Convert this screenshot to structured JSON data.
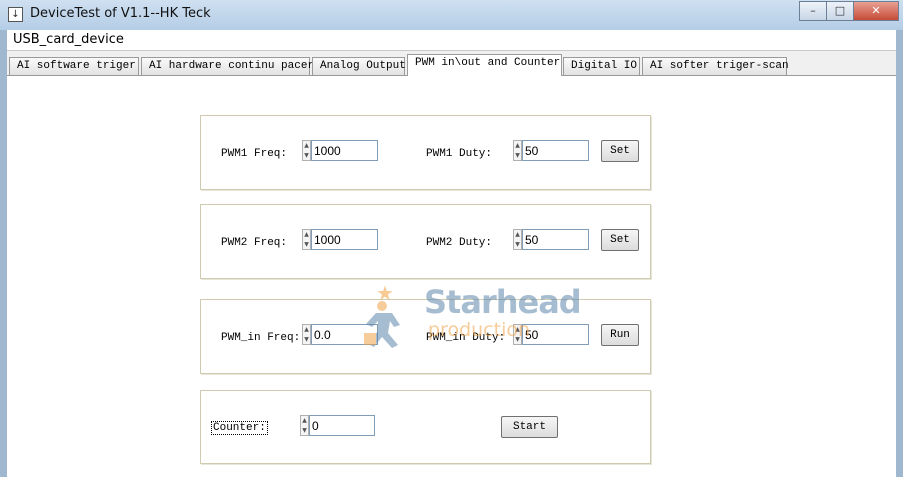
{
  "window": {
    "title": "DeviceTest of V1.1--HK Teck",
    "minimize": "–",
    "maximize": "□",
    "close": "✕"
  },
  "menu": {
    "device": "USB_card_device"
  },
  "tabs": [
    {
      "label": "AI software triger"
    },
    {
      "label": "AI hardware continu pacer"
    },
    {
      "label": "Analog Output"
    },
    {
      "label": "PWM in\\out and Counter"
    },
    {
      "label": "Digital IO"
    },
    {
      "label": "AI softer triger-scan"
    }
  ],
  "pwm1": {
    "freq_label": "PWM1 Freq:",
    "freq_value": "1000",
    "duty_label": "PWM1 Duty:",
    "duty_value": "50",
    "button": "Set"
  },
  "pwm2": {
    "freq_label": "PWM2 Freq:",
    "freq_value": "1000",
    "duty_label": "PWM2 Duty:",
    "duty_value": "50",
    "button": "Set"
  },
  "pwm_in": {
    "freq_label": "PWM_in Freq:",
    "freq_value": "0.0",
    "duty_label": "PWM_in Duty:",
    "duty_value": "50",
    "button": "Run"
  },
  "counter": {
    "label": "Counter:",
    "value": "0",
    "button": "Start"
  },
  "watermark": {
    "brand": "Starhead",
    "tagline": "production",
    "colors": {
      "blue": "#5e87ad",
      "orange": "#f0a348"
    }
  },
  "icons": {
    "spin_up": "▲",
    "spin_down": "▼",
    "app": "↓"
  }
}
